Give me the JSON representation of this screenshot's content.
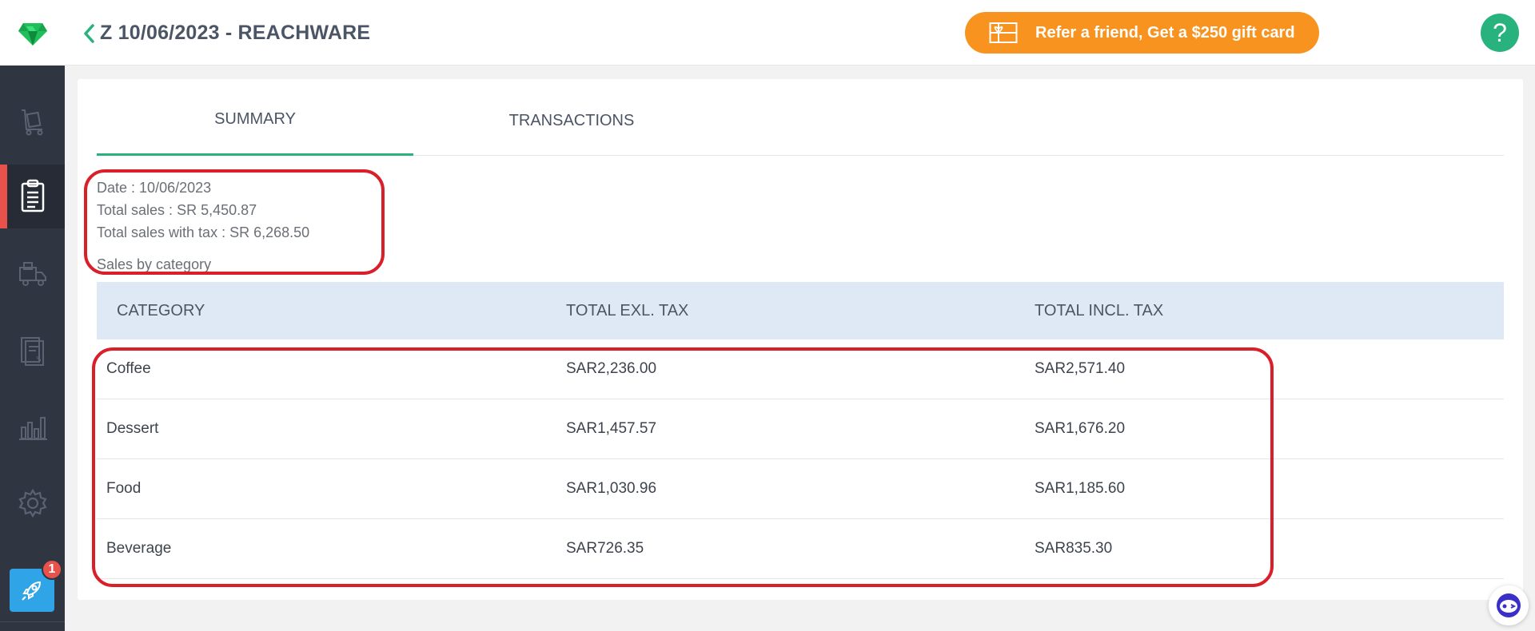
{
  "header": {
    "title": "Z 10/06/2023 - REACHWARE",
    "refer_label": "Refer a friend, Get a $250 gift card",
    "help_label": "?"
  },
  "colors": {
    "brand_green": "#27b27e",
    "refer_orange": "#f7931e",
    "sidebar_bg": "#2f3541",
    "active_marker": "#e8524a",
    "annotation_red": "#d91f2a"
  },
  "sidebar": {
    "items": [
      {
        "icon": "shopping-cart-icon",
        "active": false
      },
      {
        "icon": "clipboard-report-icon",
        "active": true
      },
      {
        "icon": "delivery-truck-icon",
        "active": false
      },
      {
        "icon": "invoice-dollar-icon",
        "active": false
      },
      {
        "icon": "bar-chart-icon",
        "active": false
      },
      {
        "icon": "gear-icon",
        "active": false
      }
    ],
    "rocket_badge": "1"
  },
  "tabs": [
    {
      "label": "SUMMARY",
      "active": true
    },
    {
      "label": "TRANSACTIONS",
      "active": false
    }
  ],
  "summary": {
    "date_label": "Date :",
    "date_value": "10/06/2023",
    "total_sales_label": "Total sales :",
    "total_sales_value": "SR 5,450.87",
    "total_tax_label": "Total sales with tax :",
    "total_tax_value": "SR 6,268.50",
    "category_title": "Sales by category"
  },
  "table": {
    "headers": [
      "CATEGORY",
      "TOTAL EXL. TAX",
      "TOTAL INCL. TAX"
    ],
    "rows": [
      {
        "category": "Coffee",
        "excl": "SAR2,236.00",
        "incl": "SAR2,571.40"
      },
      {
        "category": "Dessert",
        "excl": "SAR1,457.57",
        "incl": "SAR1,676.20"
      },
      {
        "category": "Food",
        "excl": "SAR1,030.96",
        "incl": "SAR1,185.60"
      },
      {
        "category": "Beverage",
        "excl": "SAR726.35",
        "incl": "SAR835.30"
      }
    ]
  }
}
